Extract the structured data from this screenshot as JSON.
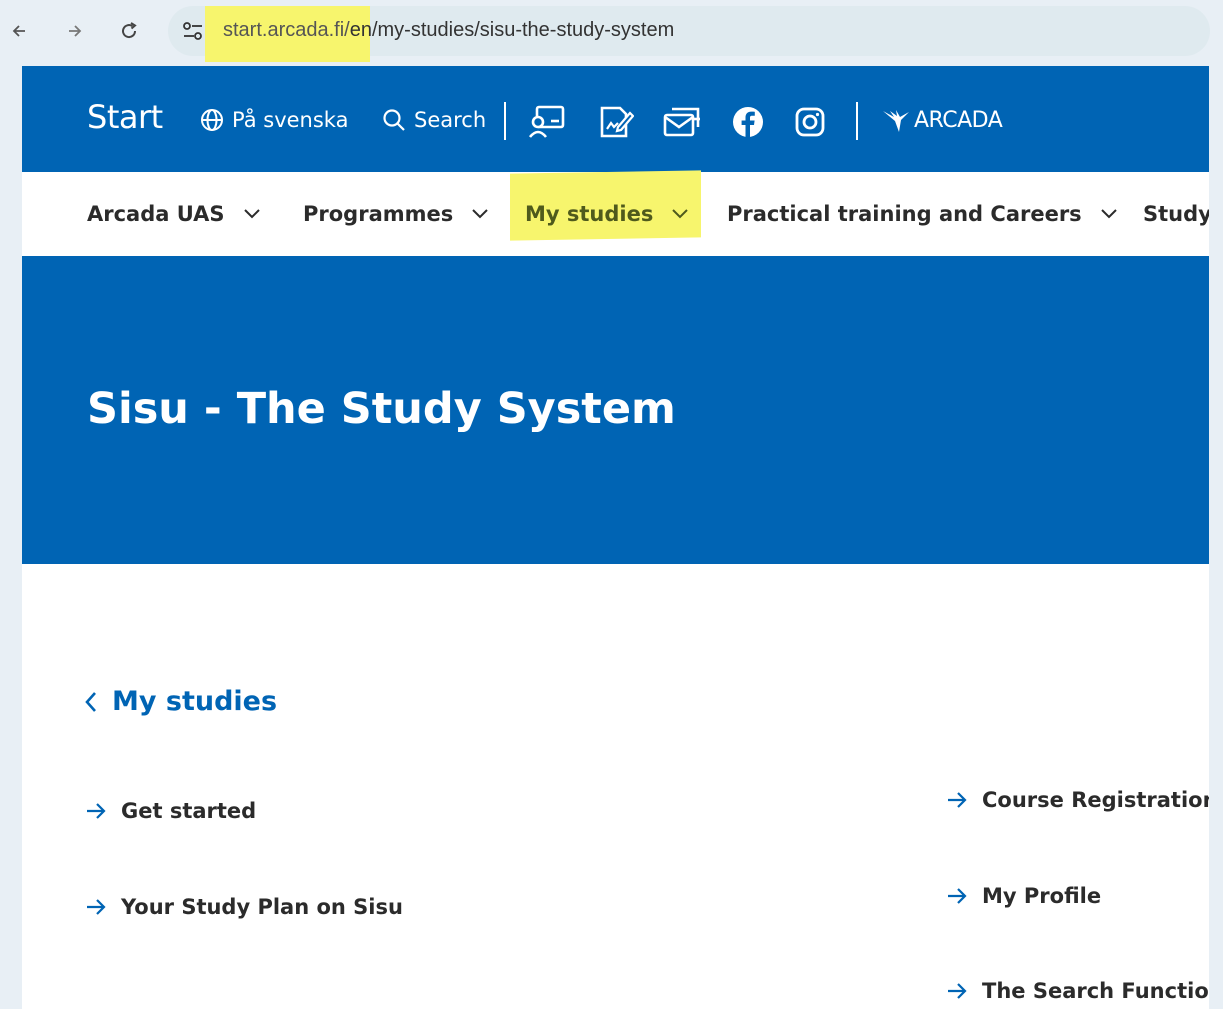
{
  "browser": {
    "url_domain": "start.arcada.fi/",
    "url_path": "en/my-studies/sisu-the-study-system"
  },
  "header": {
    "brand": "Start",
    "language_link": "På svenska",
    "search_label": "Search",
    "logo_text": "ARCADA",
    "icons": [
      "presentation-icon",
      "document-sign-icon",
      "mail-inbox-icon",
      "facebook-icon",
      "instagram-icon"
    ]
  },
  "nav": {
    "items": [
      {
        "label": "Arcada UAS"
      },
      {
        "label": "Programmes"
      },
      {
        "label": "My studies"
      },
      {
        "label": "Practical training and Careers"
      },
      {
        "label": "Study"
      }
    ]
  },
  "hero": {
    "title": "Sisu - The Study System"
  },
  "content": {
    "back_link": "My studies",
    "left_links": [
      "Get started",
      "Your Study Plan on Sisu"
    ],
    "right_links": [
      "Course Registration",
      "My Profile",
      "The Search Function"
    ]
  },
  "colors": {
    "brand_blue": "#0064b4",
    "highlight": "#f7f56d"
  }
}
